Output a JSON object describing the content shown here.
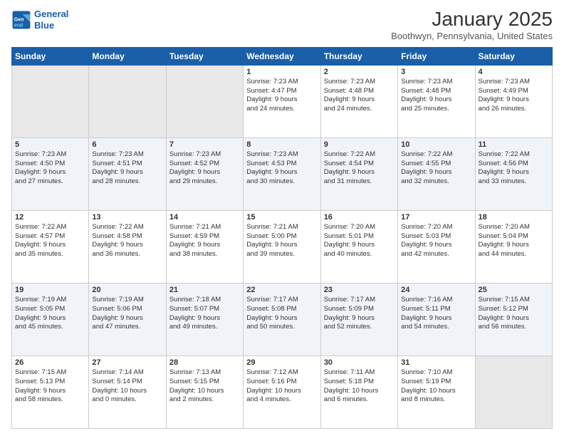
{
  "header": {
    "logo_line1": "General",
    "logo_line2": "Blue",
    "month": "January 2025",
    "location": "Boothwyn, Pennsylvania, United States"
  },
  "weekdays": [
    "Sunday",
    "Monday",
    "Tuesday",
    "Wednesday",
    "Thursday",
    "Friday",
    "Saturday"
  ],
  "weeks": [
    [
      {
        "day": "",
        "content": ""
      },
      {
        "day": "",
        "content": ""
      },
      {
        "day": "",
        "content": ""
      },
      {
        "day": "1",
        "content": "Sunrise: 7:23 AM\nSunset: 4:47 PM\nDaylight: 9 hours\nand 24 minutes."
      },
      {
        "day": "2",
        "content": "Sunrise: 7:23 AM\nSunset: 4:48 PM\nDaylight: 9 hours\nand 24 minutes."
      },
      {
        "day": "3",
        "content": "Sunrise: 7:23 AM\nSunset: 4:48 PM\nDaylight: 9 hours\nand 25 minutes."
      },
      {
        "day": "4",
        "content": "Sunrise: 7:23 AM\nSunset: 4:49 PM\nDaylight: 9 hours\nand 26 minutes."
      }
    ],
    [
      {
        "day": "5",
        "content": "Sunrise: 7:23 AM\nSunset: 4:50 PM\nDaylight: 9 hours\nand 27 minutes."
      },
      {
        "day": "6",
        "content": "Sunrise: 7:23 AM\nSunset: 4:51 PM\nDaylight: 9 hours\nand 28 minutes."
      },
      {
        "day": "7",
        "content": "Sunrise: 7:23 AM\nSunset: 4:52 PM\nDaylight: 9 hours\nand 29 minutes."
      },
      {
        "day": "8",
        "content": "Sunrise: 7:23 AM\nSunset: 4:53 PM\nDaylight: 9 hours\nand 30 minutes."
      },
      {
        "day": "9",
        "content": "Sunrise: 7:22 AM\nSunset: 4:54 PM\nDaylight: 9 hours\nand 31 minutes."
      },
      {
        "day": "10",
        "content": "Sunrise: 7:22 AM\nSunset: 4:55 PM\nDaylight: 9 hours\nand 32 minutes."
      },
      {
        "day": "11",
        "content": "Sunrise: 7:22 AM\nSunset: 4:56 PM\nDaylight: 9 hours\nand 33 minutes."
      }
    ],
    [
      {
        "day": "12",
        "content": "Sunrise: 7:22 AM\nSunset: 4:57 PM\nDaylight: 9 hours\nand 35 minutes."
      },
      {
        "day": "13",
        "content": "Sunrise: 7:22 AM\nSunset: 4:58 PM\nDaylight: 9 hours\nand 36 minutes."
      },
      {
        "day": "14",
        "content": "Sunrise: 7:21 AM\nSunset: 4:59 PM\nDaylight: 9 hours\nand 38 minutes."
      },
      {
        "day": "15",
        "content": "Sunrise: 7:21 AM\nSunset: 5:00 PM\nDaylight: 9 hours\nand 39 minutes."
      },
      {
        "day": "16",
        "content": "Sunrise: 7:20 AM\nSunset: 5:01 PM\nDaylight: 9 hours\nand 40 minutes."
      },
      {
        "day": "17",
        "content": "Sunrise: 7:20 AM\nSunset: 5:03 PM\nDaylight: 9 hours\nand 42 minutes."
      },
      {
        "day": "18",
        "content": "Sunrise: 7:20 AM\nSunset: 5:04 PM\nDaylight: 9 hours\nand 44 minutes."
      }
    ],
    [
      {
        "day": "19",
        "content": "Sunrise: 7:19 AM\nSunset: 5:05 PM\nDaylight: 9 hours\nand 45 minutes."
      },
      {
        "day": "20",
        "content": "Sunrise: 7:19 AM\nSunset: 5:06 PM\nDaylight: 9 hours\nand 47 minutes."
      },
      {
        "day": "21",
        "content": "Sunrise: 7:18 AM\nSunset: 5:07 PM\nDaylight: 9 hours\nand 49 minutes."
      },
      {
        "day": "22",
        "content": "Sunrise: 7:17 AM\nSunset: 5:08 PM\nDaylight: 9 hours\nand 50 minutes."
      },
      {
        "day": "23",
        "content": "Sunrise: 7:17 AM\nSunset: 5:09 PM\nDaylight: 9 hours\nand 52 minutes."
      },
      {
        "day": "24",
        "content": "Sunrise: 7:16 AM\nSunset: 5:11 PM\nDaylight: 9 hours\nand 54 minutes."
      },
      {
        "day": "25",
        "content": "Sunrise: 7:15 AM\nSunset: 5:12 PM\nDaylight: 9 hours\nand 56 minutes."
      }
    ],
    [
      {
        "day": "26",
        "content": "Sunrise: 7:15 AM\nSunset: 5:13 PM\nDaylight: 9 hours\nand 58 minutes."
      },
      {
        "day": "27",
        "content": "Sunrise: 7:14 AM\nSunset: 5:14 PM\nDaylight: 10 hours\nand 0 minutes."
      },
      {
        "day": "28",
        "content": "Sunrise: 7:13 AM\nSunset: 5:15 PM\nDaylight: 10 hours\nand 2 minutes."
      },
      {
        "day": "29",
        "content": "Sunrise: 7:12 AM\nSunset: 5:16 PM\nDaylight: 10 hours\nand 4 minutes."
      },
      {
        "day": "30",
        "content": "Sunrise: 7:11 AM\nSunset: 5:18 PM\nDaylight: 10 hours\nand 6 minutes."
      },
      {
        "day": "31",
        "content": "Sunrise: 7:10 AM\nSunset: 5:19 PM\nDaylight: 10 hours\nand 8 minutes."
      },
      {
        "day": "",
        "content": ""
      }
    ]
  ]
}
